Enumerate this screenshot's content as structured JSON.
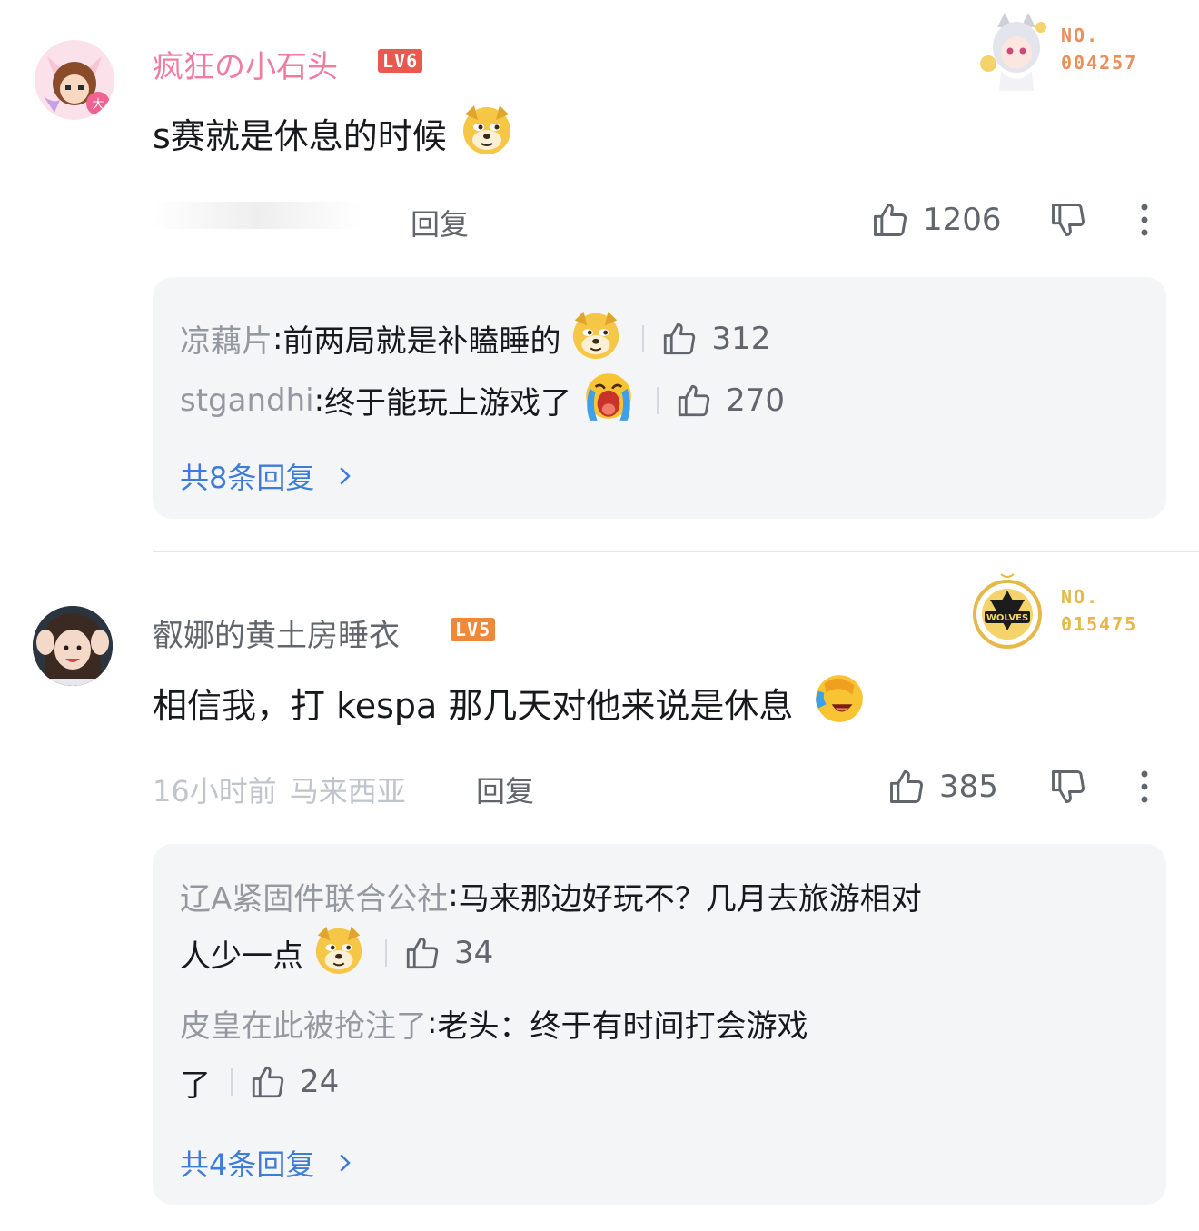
{
  "comments": [
    {
      "username": "疯狂の小石头",
      "level": "LV6",
      "level_color": "#e85a4f",
      "name_color": "#f07ca1",
      "content": "s赛就是休息的时候",
      "content_emoji": "doge-emoji",
      "meta_time": "",
      "meta_location": "",
      "reply_label": "回复",
      "likes": "1206",
      "badge": {
        "no_label": "NO.",
        "number": "004257",
        "color": "#e8905c"
      },
      "sub_replies": [
        {
          "name": "凉藕片",
          "text": "前两局就是补瞌睡的",
          "emoji": "doge-emoji",
          "likes": "312"
        },
        {
          "name": "stgandhi",
          "text": "终于能玩上游戏了",
          "emoji": "crying-emoji",
          "likes": "270"
        }
      ],
      "more_replies": "共8条回复"
    },
    {
      "username": "叡娜的黄土房睡衣",
      "level": "LV5",
      "level_color": "#f0883a",
      "name_color": "#61666d",
      "content": "相信我，打 kespa 那几天对他来说是休息",
      "content_emoji": "laughing-cry-emoji",
      "meta_time": "16小时前",
      "meta_location": "马来西亚",
      "reply_label": "回复",
      "likes": "385",
      "badge": {
        "no_label": "NO.",
        "number": "015475",
        "color": "#e6b84a",
        "logo_text": "WOLVES"
      },
      "sub_replies": [
        {
          "name": "辽A紧固件联合公社",
          "text_line1": "马来那边好玩不？几月去旅游相对",
          "text_line2": "人少一点",
          "emoji": "doge-emoji",
          "likes": "34"
        },
        {
          "name": "皮皇在此被抢注了",
          "text_line1": "老头：终于有时间打会游戏",
          "text_line2": "了",
          "likes": "24"
        }
      ],
      "more_replies": "共4条回复"
    }
  ],
  "colors": {
    "link": "#3e7cd9",
    "muted": "#9499a0",
    "bg_sub": "#f4f5f7"
  }
}
